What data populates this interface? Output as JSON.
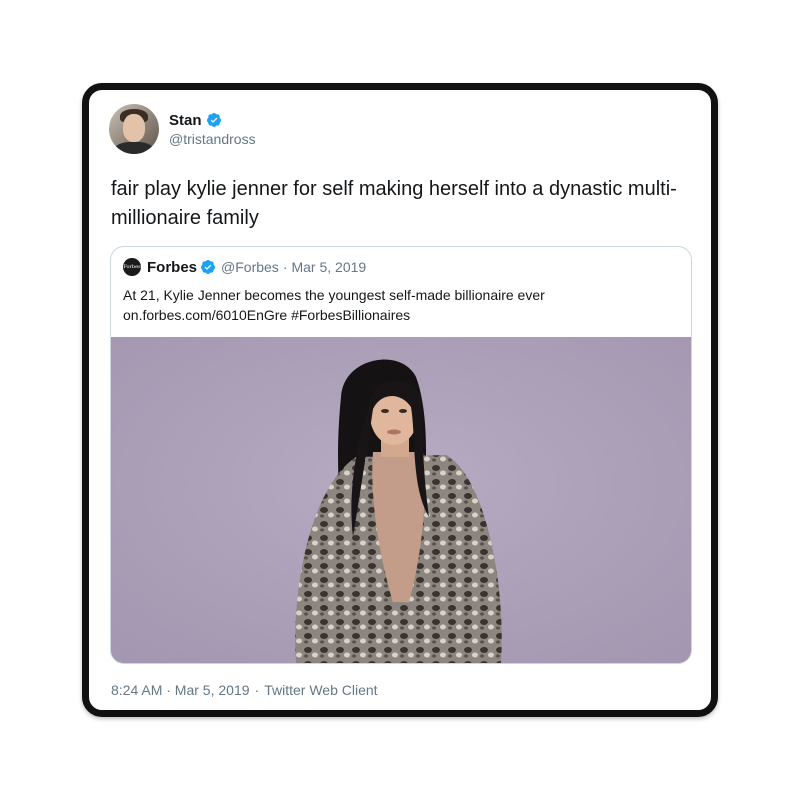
{
  "tweet": {
    "author_name": "Stan",
    "author_handle": "@tristandross",
    "text": "fair play kylie jenner for self making herself into a dynastic multi-millionaire family",
    "timestamp": "8:24 AM · Mar 5, 2019",
    "separator": "·",
    "client": "Twitter Web Client"
  },
  "quoted_tweet": {
    "author_name": "Forbes",
    "author_handle": "@Forbes",
    "separator": "·",
    "date": "Mar 5, 2019",
    "text_line1": "At 21, Kylie Jenner becomes the youngest self-made billionaire ever",
    "text_line2": "on.forbes.com/6010EnGre #ForbesBillionaires",
    "avatar_text": "Forbes"
  },
  "colors": {
    "verified_blue": "#1da1f2",
    "secondary_text": "#657786",
    "image_background": "#aea2bb"
  }
}
